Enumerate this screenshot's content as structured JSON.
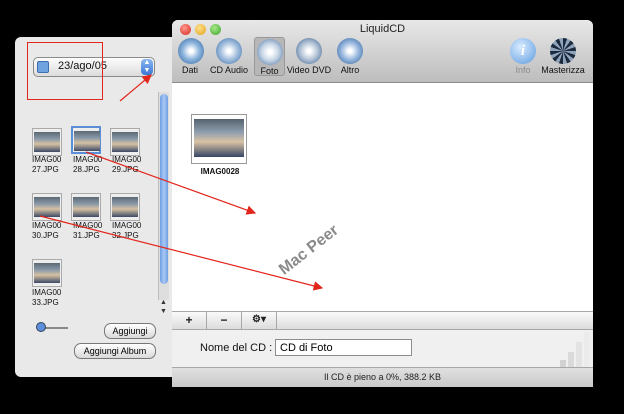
{
  "browser": {
    "album": "23/ago/05",
    "photos": [
      {
        "name": "IMAG00\n27.JPG"
      },
      {
        "name": "IMAG00\n28.JPG"
      },
      {
        "name": "IMAG00\n29.JPG"
      },
      {
        "name": "IMAG00\n30.JPG"
      },
      {
        "name": "IMAG00\n31.JPG"
      },
      {
        "name": "IMAG00\n32.JPG"
      },
      {
        "name": "IMAG00\n33.JPG"
      }
    ],
    "add_label": "Aggiungi",
    "add_album_label": "Aggiungi Album"
  },
  "window": {
    "title": "LiquidCD",
    "toolbar": [
      {
        "label": "Dati",
        "icon": "data-disc-icon"
      },
      {
        "label": "CD Audio",
        "icon": "audio-cd-icon"
      },
      {
        "label": "Foto",
        "icon": "camera-disc-icon",
        "selected": true
      },
      {
        "label": "Video DVD",
        "icon": "video-dvd-icon"
      },
      {
        "label": "Altro",
        "icon": "other-disc-icon"
      },
      {
        "label": "Info",
        "icon": "info-icon",
        "disabled": true
      },
      {
        "label": "Masterizza",
        "icon": "burn-icon"
      }
    ],
    "dropped_item": "IMAG0028",
    "watermark": "Mac Peer",
    "bar_buttons": [
      "+",
      "−",
      "⚙▾"
    ],
    "cd_name_label": "Nome del CD :",
    "cd_name_value": "CD di Foto",
    "status": "Il CD è pieno a 0%, 388.2 KB"
  },
  "colors": {
    "annotation": "#e2261c",
    "selection": "#5a8fd8"
  }
}
